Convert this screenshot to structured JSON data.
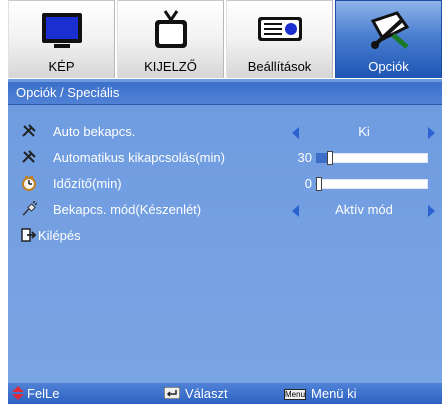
{
  "tabs": [
    {
      "label": "KÉP",
      "icon": "monitor-icon",
      "active": false
    },
    {
      "label": "KIJELZŐ",
      "icon": "tv-icon",
      "active": false
    },
    {
      "label": "Beállítások",
      "icon": "projector-icon",
      "active": false
    },
    {
      "label": "Opciók",
      "icon": "tools-icon",
      "active": true
    }
  ],
  "section_title": "Opciók / Speciális",
  "rows": [
    {
      "label": "Auto bekapcs.",
      "icon": "wrench-icon",
      "type": "select",
      "value": "Ki"
    },
    {
      "label": "Automatikus kikapcsolás(min)",
      "icon": "wrench-icon",
      "type": "slider",
      "value": "30",
      "level": 0.1
    },
    {
      "label": "Időzítő(min)",
      "icon": "clock-icon",
      "type": "slider",
      "value": "0",
      "level": 0.0
    },
    {
      "label": "Bekapcs. mód(Készenlét)",
      "icon": "power-plug-icon",
      "type": "select",
      "value": "Aktív mód"
    },
    {
      "label": "Kilépés",
      "icon": "exit-icon",
      "type": "action"
    }
  ],
  "footer": {
    "nav_label": "FelLe",
    "select_label": "Választ",
    "menu_key": "Menu",
    "menu_label": "Menü ki"
  },
  "colors": {
    "active_tab": "#1d55b4",
    "panel": "#6e9be0",
    "arrow": "#2a62d0",
    "nav_arrow": "#e0283c"
  }
}
